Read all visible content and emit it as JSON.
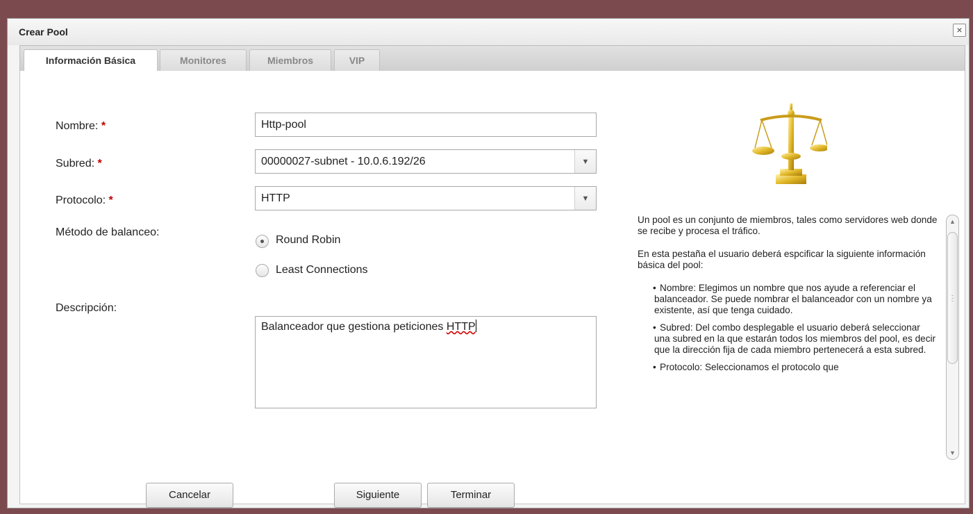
{
  "dialog": {
    "title": "Crear Pool",
    "close_label": "×"
  },
  "tabs": [
    {
      "label": "Información Básica",
      "active": true
    },
    {
      "label": "Monitores",
      "active": false
    },
    {
      "label": "Miembros",
      "active": false
    },
    {
      "label": "VIP",
      "active": false
    }
  ],
  "form": {
    "required_marker": "*",
    "nombre": {
      "label": "Nombre:",
      "value": "Http-pool"
    },
    "subred": {
      "label": "Subred:",
      "value": "00000027-subnet - 10.0.6.192/26"
    },
    "protocolo": {
      "label": "Protocolo:",
      "value": "HTTP"
    },
    "metodo": {
      "label": "Método de balanceo:",
      "options": [
        "Round Robin",
        "Least Connections"
      ],
      "selected": "Round Robin"
    },
    "descripcion": {
      "label": "Descripción:",
      "value_prefix": "Balanceador que gestiona peticiones ",
      "value_misspelled": "HTTP"
    }
  },
  "help": {
    "paragraphs": [
      "Un pool es un conjunto de miembros, tales como servidores web donde se recibe y procesa el tráfico.",
      "En esta pestaña el usuario deberá espcificar la siguiente información básica del pool:"
    ],
    "bullets": [
      "Nombre: Elegimos un nombre que nos ayude a referenciar el balanceador. Se puede nombrar el balanceador con un nombre ya existente, así que tenga cuidado.",
      "Subred: Del combo desplegable el usuario deberá seleccionar una subred en la que estarán todos los miembros del pool, es decir que la dirección fija de cada miembro pertenecerá a esta subred.",
      "Protocolo: Seleccionamos el protocolo que"
    ]
  },
  "buttons": {
    "cancel": "Cancelar",
    "next": "Siguiente",
    "finish": "Terminar"
  },
  "icons": {
    "illustration": "balance-scale-icon",
    "select_arrow": "chevron-down-icon"
  },
  "colors": {
    "required": "#c00000",
    "scale_gold": "#e3b92a",
    "background": "#7b4a4f"
  }
}
